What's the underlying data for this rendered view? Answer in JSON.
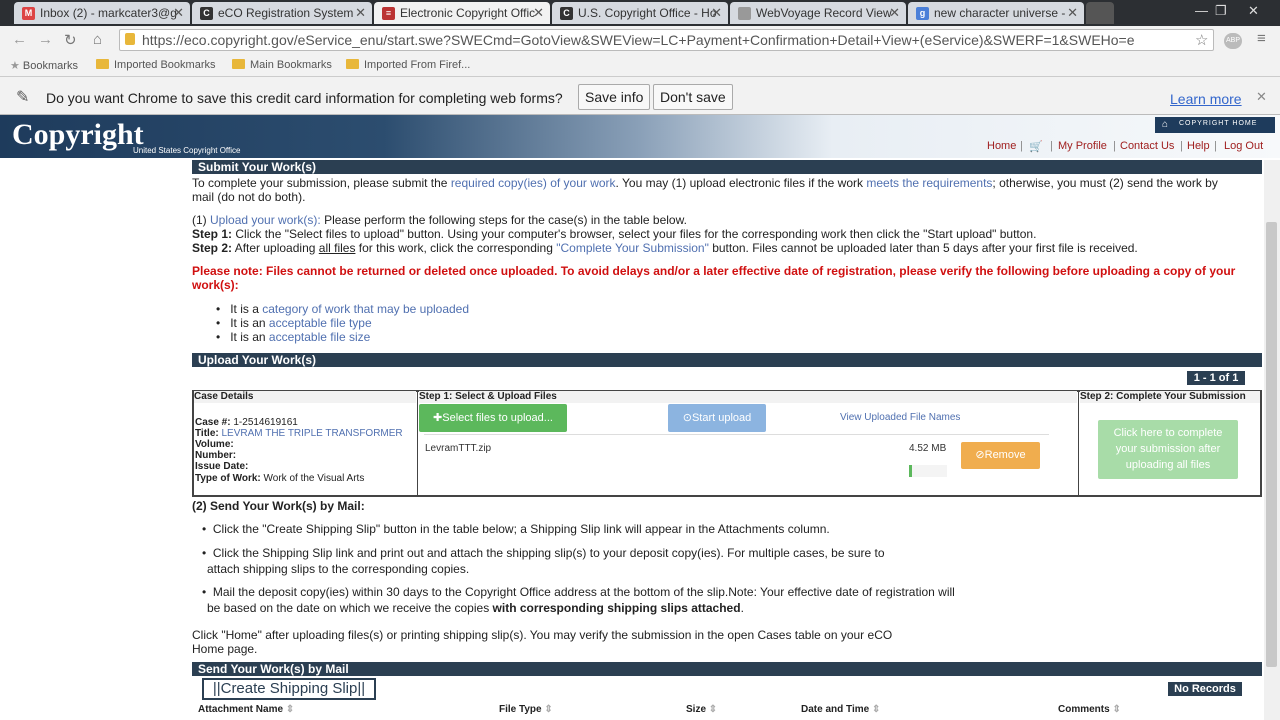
{
  "browser": {
    "tabs": [
      {
        "label": "Inbox (2) - markcater3@g",
        "icon": "gmail-icon"
      },
      {
        "label": "eCO Registration System",
        "icon": "copyright-icon"
      },
      {
        "label": "Electronic Copyright Offic",
        "icon": "flag-icon"
      },
      {
        "label": "U.S. Copyright Office - Ho",
        "icon": "copyright-icon"
      },
      {
        "label": "WebVoyage Record View",
        "icon": "page-icon"
      },
      {
        "label": "new character universe - ",
        "icon": "google-icon"
      }
    ],
    "url": "https://eco.copyright.gov/eService_enu/start.swe?SWECmd=GotoView&SWEView=LC+Payment+Confirmation+Detail+View+(eService)&SWERF=1&SWEHo=e",
    "bookmarks": [
      "Bookmarks",
      "Imported Bookmarks",
      "Main Bookmarks",
      "Imported From Firef..."
    ],
    "infobar": {
      "message": "Do you want Chrome to save this credit card information for completing web forms?",
      "save": "Save info",
      "dont_save": "Don't save",
      "learn_more": "Learn more"
    }
  },
  "site": {
    "logo": "Copyright",
    "logo_sub": "United States Copyright Office",
    "home_badge": "COPYRIGHT HOME",
    "nav": [
      "Home",
      "My Profile",
      "Contact Us",
      "Help",
      "Log Out"
    ]
  },
  "submit": {
    "heading": "Submit Your Work(s)",
    "intro_a": "To complete your submission, please submit the",
    "intro_link1": "required copy(ies) of your work",
    "intro_b": ". You may (1) upload electronic files if the work",
    "intro_link2": "meets the requirements",
    "intro_c": "; otherwise, you must (2) send the work by",
    "intro_line2": "mail (do not do both).",
    "upload_prefix": "(1)",
    "upload_link": "Upload your work(s):",
    "upload_text": "Please perform the following steps for the case(s) in the table below.",
    "step1_label": "Step 1:",
    "step1_text": "Click the \"Select files to upload\" button. Using your computer's browser, select your files for the corresponding work then click the \"Start upload\" button.",
    "step2_label": "Step 2:",
    "step2_a": "After uploading",
    "step2_all": "all files",
    "step2_b": "for this work, click the corresponding",
    "step2_link": "\"Complete Your Submission\"",
    "step2_c": "button. Files cannot be uploaded later than 5 days after your first file is received.",
    "note_line1": "Please note: Files cannot be returned or deleted once uploaded. To avoid delays and/or a later effective date of registration, please verify the following before uploading a copy of your",
    "note_line2": "work(s):",
    "bullets": [
      {
        "prefix": "It is a",
        "link": "category of work that may be uploaded"
      },
      {
        "prefix": "It is an",
        "link": "acceptable file type"
      },
      {
        "prefix": "It is an",
        "link": "acceptable file size"
      }
    ]
  },
  "upload": {
    "heading": "Upload Your Work(s)",
    "pager": "1 - 1 of 1",
    "col_case": "Case Details",
    "col_step1": "Step 1: Select & Upload Files",
    "col_step2": "Step 2: Complete Your Submission",
    "case_num_label": "Case #:",
    "case_num": "1-2514619161",
    "title_label": "Title:",
    "title": "LEVRAM THE TRIPLE TRANSFORMER",
    "volume_label": "Volume:",
    "number_label": "Number:",
    "issue_label": "Issue Date:",
    "type_label": "Type of Work:",
    "type": "Work of the Visual Arts",
    "select_btn": "Select files to upload...",
    "start_btn": "Start upload",
    "view_link": "View Uploaded File Names",
    "file_name": "LevramTTT.zip",
    "file_size": "4.52 MB",
    "remove_btn": "Remove",
    "complete_btn_1": "Click here to complete",
    "complete_btn_2": "your submission after",
    "complete_btn_3": "uploading all files",
    "progress": 0.08
  },
  "mail": {
    "heading": "(2) Send Your Work(s) by Mail:",
    "b1": "Click the \"Create Shipping Slip\" button in the table below; a Shipping Slip link will appear in the Attachments column.",
    "b2_1": "Click the Shipping Slip link and print out and attach the shipping slip(s) to your deposit copy(ies). For multiple cases, be sure to",
    "b2_2": "attach shipping slips to the corresponding copies.",
    "b3_1": "Mail the deposit copy(ies) within 30 days to the Copyright Office address at the bottom of the slip.Note: Your effective date of registration will",
    "b3_2a": "be based on the date on which we receive the copies",
    "b3_2b": "with corresponding shipping slips attached",
    "b3_2c": ".",
    "home_1": "Click \"Home\" after uploading files(s) or printing shipping slip(s). You may verify the submission in the open Cases table on your eCO",
    "home_2": "Home page.",
    "bar": "Send Your Work(s) by Mail",
    "ship_btn": "Create Shipping Slip",
    "no_records": "No Records",
    "cols": [
      "Attachment Name",
      "File Type",
      "Size",
      "Date and Time",
      "Comments"
    ]
  }
}
